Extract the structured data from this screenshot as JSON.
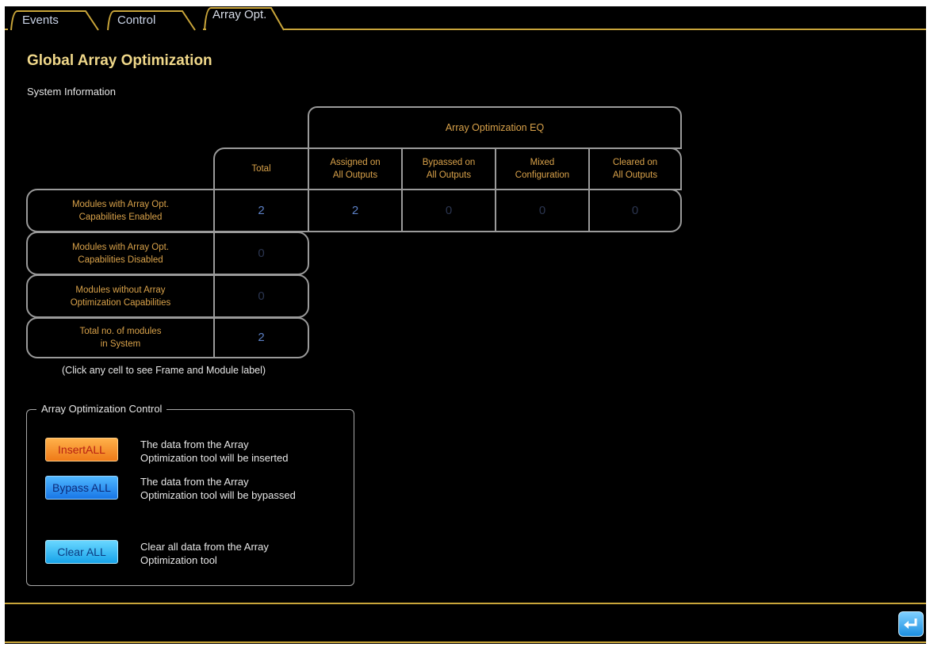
{
  "tabs": [
    {
      "label": "Events",
      "active": false
    },
    {
      "label": "Control",
      "active": false
    },
    {
      "label": "Array Opt.",
      "active": true
    }
  ],
  "page": {
    "title": "Global Array Optimization",
    "subtitle": "System Information"
  },
  "table": {
    "group_header": "Array Optimization EQ",
    "col_total": "Total",
    "columns": [
      "Assigned on\nAll Outputs",
      "Bypassed on\nAll Outputs",
      "Mixed\nConfiguration",
      "Cleared on\nAll Outputs"
    ],
    "rows": [
      {
        "label": "Modules with Array Opt.\nCapabilities Enabled",
        "total": "2",
        "values": [
          "2",
          "0",
          "0",
          "0"
        ]
      },
      {
        "label": "Modules with Array Opt.\nCapabilities Disabled",
        "total": "0"
      },
      {
        "label": "Modules without Array\nOptimization Capabilities",
        "total": "0"
      },
      {
        "label": "Total no. of modules\nin System",
        "total": "2"
      }
    ],
    "hint": "(Click any cell to see Frame and Module label)"
  },
  "control": {
    "legend": "Array Optimization Control",
    "insert_label": "InsertALL",
    "insert_desc": "The data from the Array\nOptimization tool will be inserted",
    "bypass_label": "Bypass ALL",
    "bypass_desc": "The data from the Array\nOptimization tool will be bypassed",
    "clear_label": "Clear ALL",
    "clear_desc": "Clear all data from the Array\nOptimization tool"
  },
  "icons": {
    "enter": "enter-return-icon"
  },
  "colors": {
    "accent_line": "#c9a53a",
    "title": "#f0d88a",
    "cell_text": "#d9a24a",
    "value": "#5b7fc4"
  }
}
